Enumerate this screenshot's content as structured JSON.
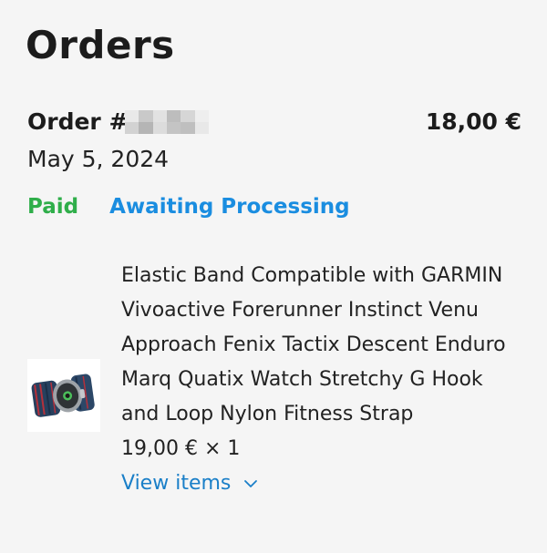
{
  "page": {
    "title": "Orders"
  },
  "order": {
    "label": "Order #",
    "total": "18,00 €",
    "date": "May 5, 2024",
    "status_payment": "Paid",
    "status_fulfillment": "Awaiting Processing",
    "colors": {
      "paid": "#2fae4a",
      "fulfillment": "#1a8de0",
      "link": "#1a7fc8"
    },
    "items": [
      {
        "name": "Elastic Band Compatible with GARMIN Vivoactive Forerunner Instinct Venu Approach Fenix Tactix Descent Enduro Marq Quatix Watch Stretchy G Hook and Loop Nylon Fitness Strap",
        "price_qty": "19,00 € × 1",
        "image_icon": "watch-strap-image"
      }
    ],
    "view_items_label": "View items",
    "view_items_icon": "chevron-down-icon"
  }
}
